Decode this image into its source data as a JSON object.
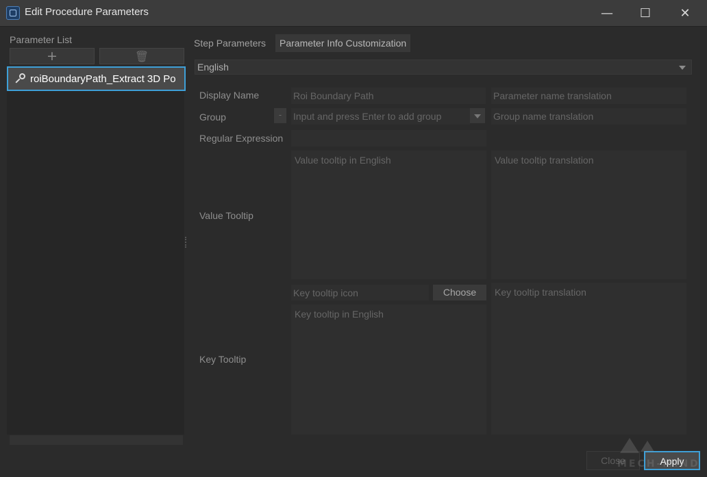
{
  "window": {
    "title": "Edit Procedure Parameters",
    "minimize_glyph": "—",
    "maximize_glyph": "☐",
    "close_glyph": "✕"
  },
  "sidebar": {
    "title": "Parameter List",
    "add_glyph": "+",
    "delete_glyph": "🗑",
    "items": [
      {
        "label": "roiBoundaryPath_Extract 3D Po",
        "icon": "pin-icon",
        "selected": true
      }
    ]
  },
  "tabs": [
    {
      "label": "Step Parameters",
      "active": false
    },
    {
      "label": "Parameter Info Customization",
      "active": true
    }
  ],
  "language": {
    "selected": "English"
  },
  "form": {
    "display_name": {
      "label": "Display Name",
      "value_placeholder": "Roi Boundary Path",
      "translation_placeholder": "Parameter name translation"
    },
    "group": {
      "label": "Group",
      "small_button": "-",
      "input_placeholder": "Input and press Enter to add group",
      "translation_placeholder": "Group name translation"
    },
    "regular_expression": {
      "label": "Regular Expression"
    },
    "value_tooltip": {
      "label": "Value Tooltip",
      "english_placeholder": "Value tooltip in English",
      "translation_placeholder": "Value tooltip translation"
    },
    "key_tooltip": {
      "label": "Key Tooltip",
      "icon_placeholder": "Key tooltip icon",
      "choose_label": "Choose",
      "translation_placeholder": "Key tooltip translation",
      "english_placeholder": "Key tooltip in English"
    }
  },
  "footer": {
    "close_label": "Close",
    "apply_label": "Apply"
  },
  "watermark": {
    "text": "MECH-MIND"
  },
  "colors": {
    "accent": "#3ea0d8",
    "background": "#2b2b2b",
    "titlebar": "#3c3c3c"
  }
}
